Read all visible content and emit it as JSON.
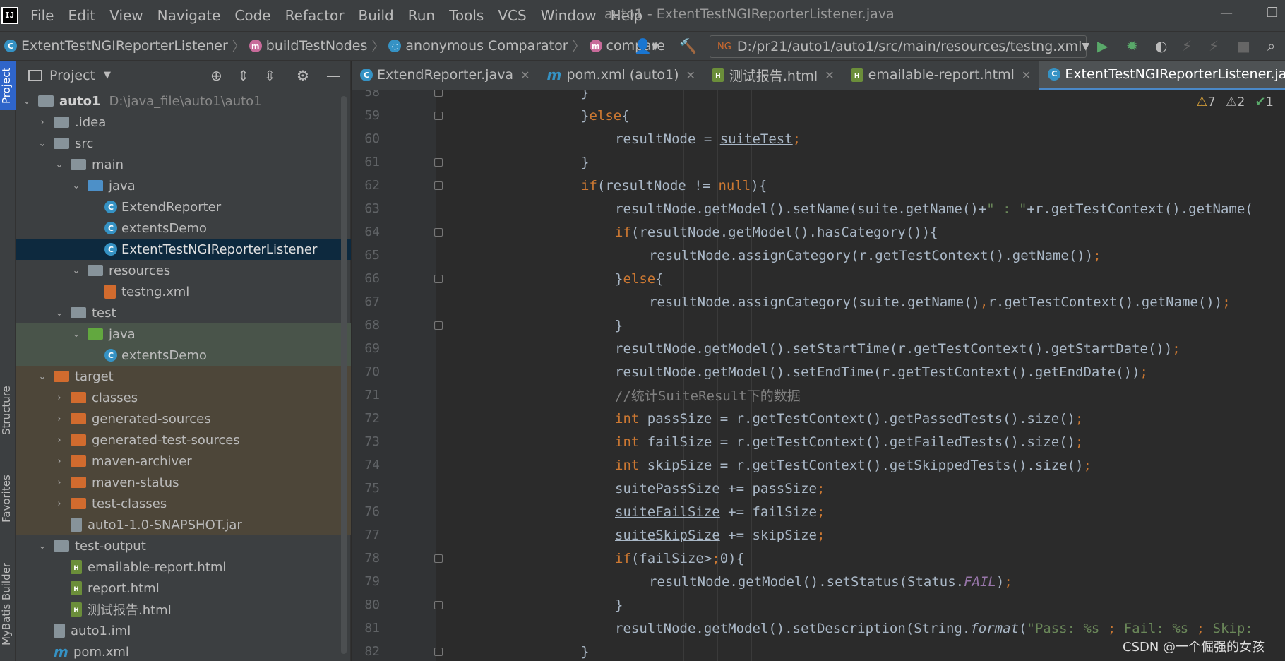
{
  "menubar": {
    "items": [
      "File",
      "Edit",
      "View",
      "Navigate",
      "Code",
      "Refactor",
      "Build",
      "Run",
      "Tools",
      "VCS",
      "Window",
      "Help"
    ],
    "window_title": "auto1 - ExtentTestNGIReporterListener.java"
  },
  "navbar": {
    "crumbs": [
      "ExtentTestNGIReporterListener",
      "buildTestNodes",
      "anonymous Comparator",
      "compare"
    ],
    "run_config": "D:/pr21/auto1/auto1/src/main/resources/testng.xml"
  },
  "sidebar_strip": {
    "project": "Project",
    "structure": "Structure",
    "favorites": "Favorites",
    "mybatis": "MyBatis Builder"
  },
  "project_panel": {
    "title": "Project",
    "root_name": "auto1",
    "root_path": "D:\\java_file\\auto1\\auto1",
    "tree": [
      "auto1",
      ".idea",
      "src",
      "main",
      "java",
      "ExtendReporter",
      "extentsDemo",
      "ExtentTestNGIReporterListener",
      "resources",
      "testng.xml",
      "test",
      "java",
      "extentsDemo",
      "target",
      "classes",
      "generated-sources",
      "generated-test-sources",
      "maven-archiver",
      "maven-status",
      "test-classes",
      "auto1-1.0-SNAPSHOT.jar",
      "test-output",
      "emailable-report.html",
      "report.html",
      "测试报告.html",
      "auto1.iml",
      "pom.xml"
    ]
  },
  "tabs": [
    "ExtendReporter.java",
    "pom.xml (auto1)",
    "测试报告.html",
    "emailable-report.html",
    "ExtentTestNGIReporterListener.java"
  ],
  "inspections": {
    "warnings": "7",
    "weak_warnings": "2",
    "ok": "1"
  },
  "editor": {
    "line_numbers": [
      "58",
      "59",
      "60",
      "61",
      "62",
      "63",
      "64",
      "65",
      "66",
      "67",
      "68",
      "69",
      "70",
      "71",
      "72",
      "73",
      "74",
      "75",
      "76",
      "77",
      "78",
      "79",
      "80",
      "81",
      "82"
    ],
    "lines": [
      "}",
      "}else{",
      "resultNode = suiteTest;",
      "}",
      "if(resultNode != null){",
      "resultNode.getModel().setName(suite.getName()+\" : \"+r.getTestContext().getName(",
      "if(resultNode.getModel().hasCategory()){",
      "resultNode.assignCategory(r.getTestContext().getName());",
      "}else{",
      "resultNode.assignCategory(suite.getName(),r.getTestContext().getName());",
      "}",
      "resultNode.getModel().setStartTime(r.getTestContext().getStartDate());",
      "resultNode.getModel().setEndTime(r.getTestContext().getEndDate());",
      "//统计SuiteResult下的数据",
      "int passSize = r.getTestContext().getPassedTests().size();",
      "int failSize = r.getTestContext().getFailedTests().size();",
      "int skipSize = r.getTestContext().getSkippedTests().size();",
      "suitePassSize += passSize;",
      "suiteFailSize += failSize;",
      "suiteSkipSize += skipSize;",
      "if(failSize>0){",
      "resultNode.getModel().setStatus(Status.FAIL);",
      "}",
      "resultNode.getModel().setDescription(String.format(\"Pass: %s ; Fail: %s ; Skip:",
      "}"
    ]
  },
  "watermark": "CSDN @一个倔强的女孩",
  "colors": {
    "keyword": "#cc7832",
    "string": "#6a8759",
    "number": "#6897bb",
    "comment": "#808080",
    "selection": "#0d293e",
    "accent": "#4a88c7"
  }
}
